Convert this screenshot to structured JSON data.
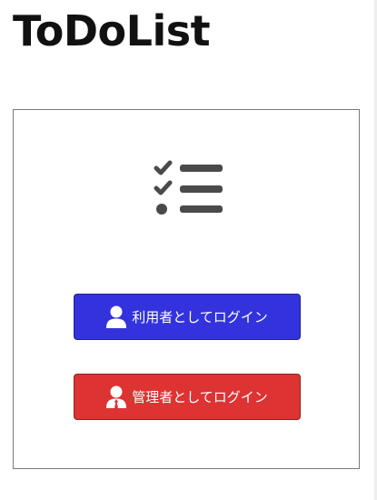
{
  "app": {
    "title": "ToDoList"
  },
  "login": {
    "logo_icon": "checklist-icon",
    "user_button": {
      "label": "利用者としてログイン",
      "icon": "user-icon",
      "color": "#3333dd"
    },
    "admin_button": {
      "label": "管理者としてログイン",
      "icon": "user-tie-icon",
      "color": "#dd3333"
    }
  }
}
